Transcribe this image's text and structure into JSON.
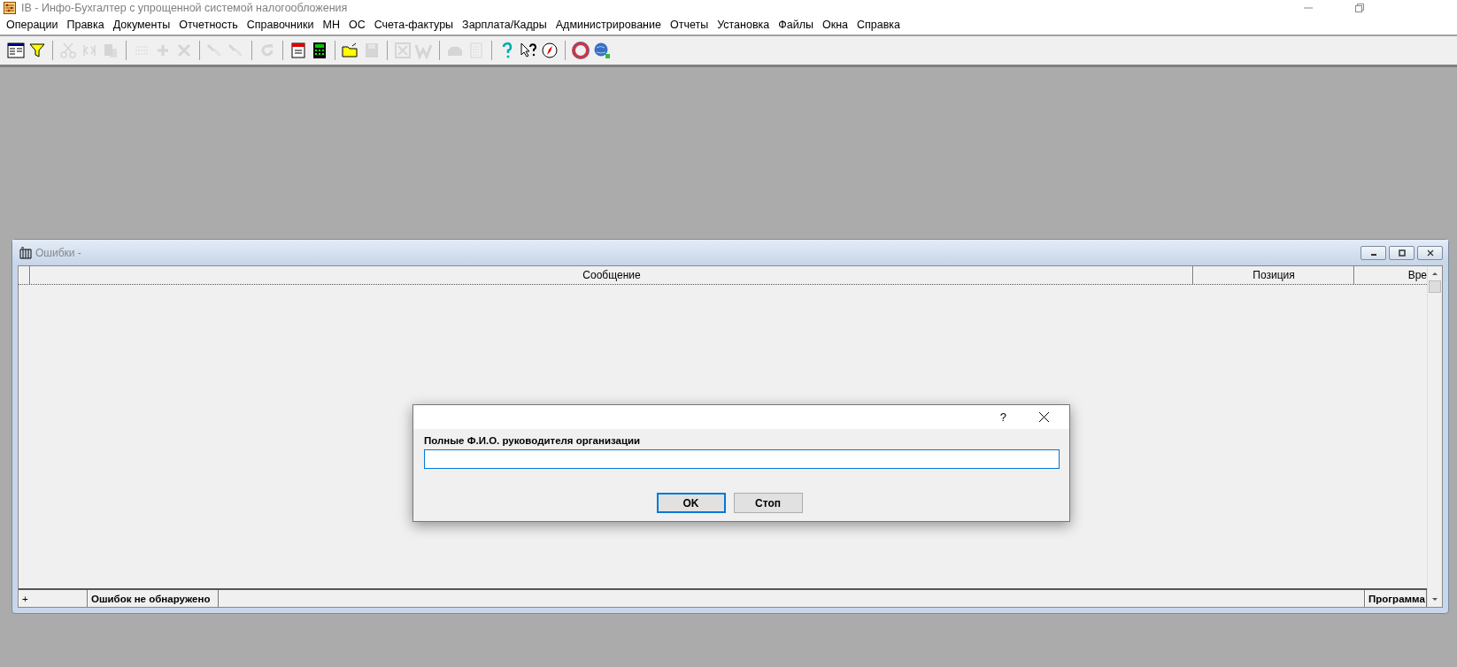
{
  "window": {
    "title": "IB - Инфо-Бухгалтер с упрощенной системой налогообложения"
  },
  "menu": [
    "Операции",
    "Правка",
    "Документы",
    "Отчетность",
    "Справочники",
    "МН",
    "ОС",
    "Счета-фактуры",
    "Зарплата/Кадры",
    "Администрирование",
    "Отчеты",
    "Установка",
    "Файлы",
    "Окна",
    "Справка"
  ],
  "toolbar": [
    [
      {
        "disabled": false
      },
      {
        "disabled": false
      }
    ],
    [
      {
        "disabled": true
      },
      {
        "disabled": true
      },
      {
        "disabled": true
      }
    ],
    [
      {
        "disabled": true
      },
      {
        "disabled": true
      },
      {
        "disabled": true
      }
    ],
    [
      {
        "disabled": true
      },
      {
        "disabled": true
      }
    ],
    [
      {
        "disabled": true
      }
    ],
    [
      {
        "disabled": false
      },
      {
        "disabled": false
      }
    ],
    [
      {
        "disabled": false
      },
      {
        "disabled": true
      }
    ],
    [
      {
        "disabled": true
      },
      {
        "disabled": true
      }
    ],
    [
      {
        "disabled": true
      },
      {
        "disabled": true
      }
    ],
    [
      {
        "disabled": false
      },
      {
        "disabled": false
      },
      {
        "disabled": false
      }
    ],
    [
      {
        "disabled": false
      },
      {
        "disabled": false
      }
    ]
  ],
  "child_window": {
    "title": "Ошибки -",
    "columns": [
      "Сообщение",
      "Позиция",
      "Вре"
    ],
    "status_bar": [
      "+",
      "Ошибок не обнаружено",
      "Программа"
    ]
  },
  "dialog": {
    "help": "?",
    "label": "Полные Ф.И.О. руководителя организации",
    "buttons": [
      {
        "label": "OK",
        "selected": true
      },
      {
        "label": "Стоп",
        "selected": false
      }
    ]
  }
}
